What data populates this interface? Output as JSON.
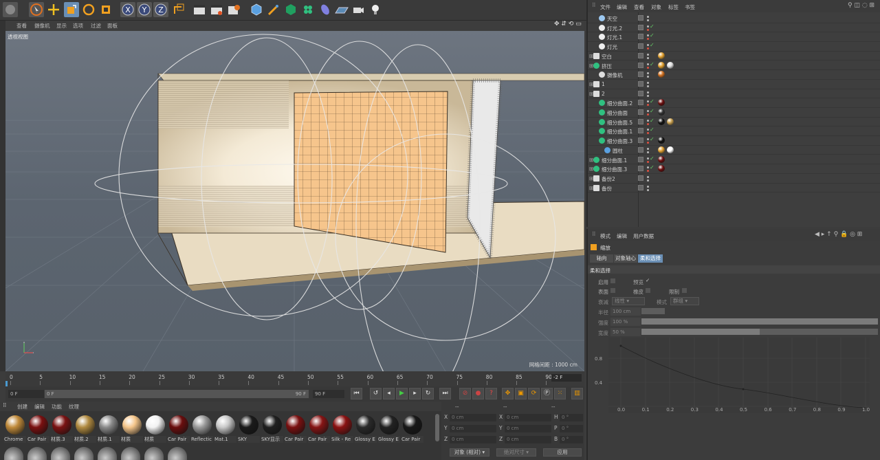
{
  "viewport_menu": [
    "查看",
    "摄像机",
    "显示",
    "选项",
    "过滤",
    "面板"
  ],
  "viewport_name": "透视视图",
  "grid_info": "网格间距 : 1000 cm",
  "timeline": {
    "ticks": [
      "0",
      "5",
      "10",
      "15",
      "20",
      "25",
      "30",
      "35",
      "40",
      "45",
      "50",
      "55",
      "60",
      "65",
      "70",
      "75",
      "80",
      "85",
      "90"
    ],
    "current": "-2 F",
    "start": "0 F",
    "range_start": "0 F",
    "range_end": "90 F",
    "end": "90 F"
  },
  "material_menu": [
    "创建",
    "编辑",
    "功能",
    "纹理"
  ],
  "materials": [
    {
      "label": "Chrome",
      "color": "#c08a3a"
    },
    {
      "label": "Car Pair",
      "color": "#7a1010"
    },
    {
      "label": "材质.3",
      "color": "#7a1212"
    },
    {
      "label": "材质.2",
      "color": "#b08a40"
    },
    {
      "label": "材质.1",
      "color": "#8a8a8a"
    },
    {
      "label": "材质",
      "color": "#f4c58a"
    },
    {
      "label": "材质",
      "color": "#f2f2f2"
    },
    {
      "label": "Car Pair",
      "color": "#6a0e0e"
    },
    {
      "label": "Reflectic",
      "color": "#9a9a9a"
    },
    {
      "label": "Mat.1",
      "color": "#c8c8c8"
    },
    {
      "label": "SKY",
      "color": "#1a1a1a"
    },
    {
      "label": "SKY显示",
      "color": "#202020"
    },
    {
      "label": "Car Pair",
      "color": "#7a1010"
    },
    {
      "label": "Car Pair",
      "color": "#861414"
    },
    {
      "label": "Silk - Re",
      "color": "#8a1212"
    },
    {
      "label": "Glossy E",
      "color": "#2a2a2a"
    },
    {
      "label": "Glossy E",
      "color": "#222"
    },
    {
      "label": "Car Pair",
      "color": "#181818"
    }
  ],
  "coords": {
    "header": [
      "--",
      "--",
      "--"
    ],
    "rows": [
      {
        "a": "X",
        "v1": "0 cm",
        "b": "X",
        "v2": "0 cm",
        "c": "H",
        "v3": "0 °"
      },
      {
        "a": "Y",
        "v1": "0 cm",
        "b": "Y",
        "v2": "0 cm",
        "c": "P",
        "v3": "0 °"
      },
      {
        "a": "Z",
        "v1": "0 cm",
        "b": "Z",
        "v2": "0 cm",
        "c": "B",
        "v3": "0 °"
      }
    ],
    "mode": "对象 (相对)",
    "size": "绝对尺寸",
    "apply": "应用"
  },
  "om_menu": [
    "文件",
    "编辑",
    "查看",
    "对象",
    "标签",
    "书签"
  ],
  "objects": [
    {
      "name": "天空",
      "indent": 14,
      "icon": "sky-icon",
      "check": false,
      "tags": []
    },
    {
      "name": "灯光.2",
      "indent": 14,
      "icon": "light-icon",
      "check": true,
      "tags": []
    },
    {
      "name": "灯光.1",
      "indent": 14,
      "icon": "light-icon",
      "check": true,
      "tags": []
    },
    {
      "name": "灯光",
      "indent": 14,
      "icon": "light-icon",
      "check": true,
      "tags": []
    },
    {
      "name": "空白",
      "indent": 6,
      "icon": "null-icon",
      "check": false,
      "tags": [
        "#e0a030"
      ]
    },
    {
      "name": "挤压",
      "indent": 6,
      "icon": "extrude-icon",
      "check": true,
      "tags": [
        "#e0a030",
        "#dddddd"
      ]
    },
    {
      "name": "摄像机",
      "indent": 14,
      "icon": "camera-icon",
      "check": false,
      "tags": [
        "#d07020"
      ]
    },
    {
      "name": "1",
      "indent": 6,
      "icon": "null-icon",
      "check": false,
      "tags": []
    },
    {
      "name": "2",
      "indent": 6,
      "icon": "null-icon",
      "check": false,
      "tags": []
    },
    {
      "name": "细分曲面.2",
      "indent": 14,
      "icon": "subdiv-icon",
      "check": true,
      "tags": [
        "#6a0e0e"
      ]
    },
    {
      "name": "细分曲面",
      "indent": 14,
      "icon": "subdiv-icon",
      "check": true,
      "tags": [
        "#333333"
      ]
    },
    {
      "name": "细分曲面.5",
      "indent": 14,
      "icon": "subdiv-icon",
      "check": true,
      "tags": [
        "#111111",
        "#c8a050"
      ]
    },
    {
      "name": "细分曲面.1",
      "indent": 14,
      "icon": "subdiv-icon",
      "check": true,
      "tags": []
    },
    {
      "name": "细分曲面.3",
      "indent": 14,
      "icon": "subdiv-icon",
      "check": true,
      "tags": [
        "#111111"
      ]
    },
    {
      "name": "圆柱",
      "indent": 22,
      "icon": "cylinder-icon",
      "check": false,
      "tags": [
        "#e0a030",
        "#ffffff"
      ]
    },
    {
      "name": "细分曲面.1",
      "indent": 6,
      "icon": "subdiv-icon",
      "check": true,
      "tags": [
        "#6a0e0e"
      ]
    },
    {
      "name": "细分曲面.3",
      "indent": 6,
      "icon": "subdiv-icon",
      "check": true,
      "tags": [
        "#6a0e0e"
      ]
    },
    {
      "name": "备份2",
      "indent": 6,
      "icon": "null-icon",
      "check": false,
      "tags": []
    },
    {
      "name": "备份",
      "indent": 6,
      "icon": "null-icon",
      "check": false,
      "tags": []
    }
  ],
  "am_menu": [
    "模式",
    "编辑",
    "用户数据"
  ],
  "am": {
    "title": "缩放",
    "tabs": [
      "轴向",
      "对象轴心",
      "柔和选择"
    ],
    "section": "柔和选择",
    "enable": "启用",
    "preview": "预览",
    "surface": "表面",
    "rubber": "橡皮",
    "restrict": "限制",
    "falloff_label": "衰减",
    "falloff": "线性",
    "mode_label": "模式",
    "mode": "群组",
    "radius_label": "半径",
    "radius": "100 cm",
    "strength_label": "强度",
    "strength": "100 %",
    "width_label": "宽度",
    "width": "50 %",
    "graph_y": [
      "0.8",
      "0.4"
    ],
    "graph_x": [
      "0.0",
      "0.1",
      "0.2",
      "0.3",
      "0.4",
      "0.5",
      "0.6",
      "0.7",
      "0.8",
      "0.9",
      "1.0"
    ]
  }
}
